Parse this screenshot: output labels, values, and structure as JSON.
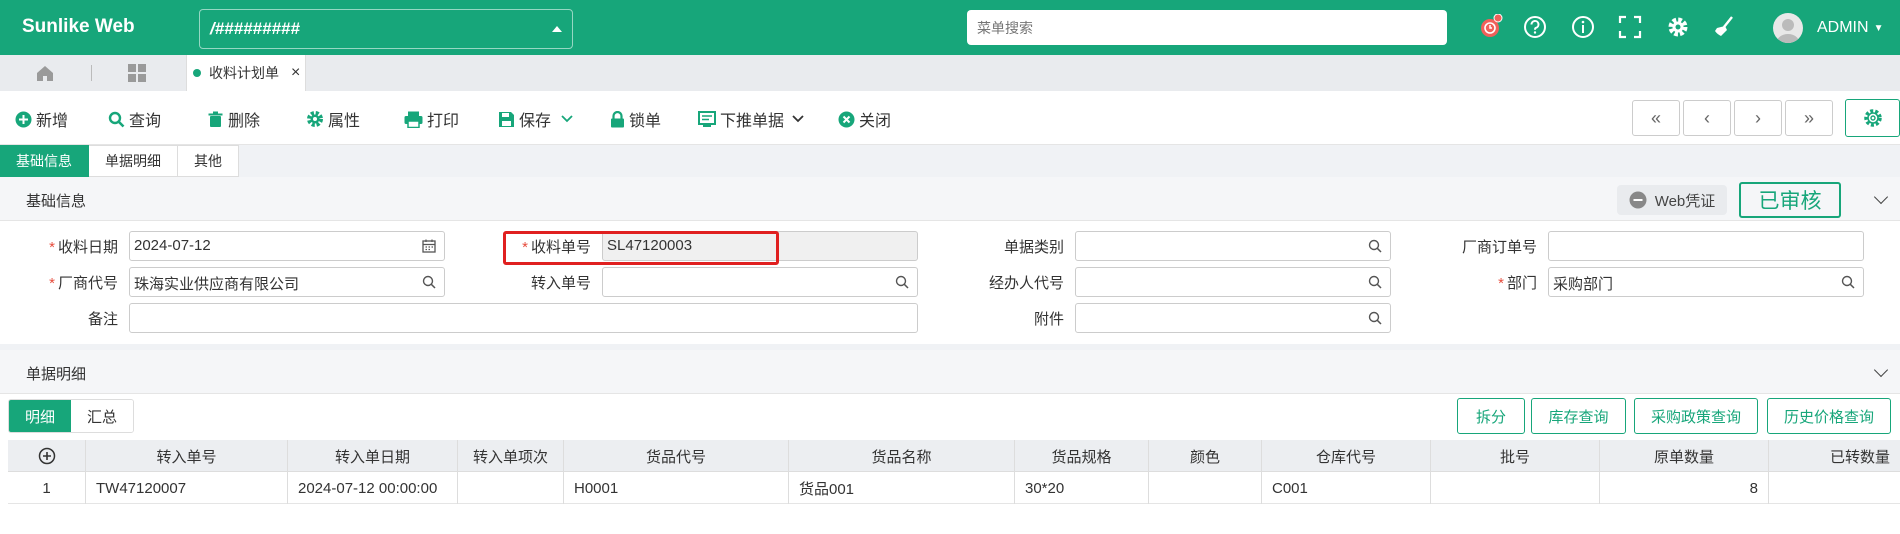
{
  "app": {
    "brand": "Sunlike Web",
    "db_select": "/#########",
    "menu_search_placeholder": "菜单搜索",
    "user": "ADMIN"
  },
  "tabs": {
    "active_tab": "收料计划单"
  },
  "toolbar": {
    "add": "新增",
    "query": "查询",
    "delete": "删除",
    "properties": "属性",
    "print": "打印",
    "save": "保存",
    "lock": "锁单",
    "push_down": "下推单据",
    "close": "关闭"
  },
  "section_tabs": [
    "基础信息",
    "单据明细",
    "其他"
  ],
  "basic": {
    "title": "基础信息",
    "web_voucher": "Web凭证",
    "status": "已审核",
    "fields": {
      "receive_date_label": "收料日期",
      "receive_date": "2024-07-12",
      "receive_no_label": "收料单号",
      "receive_no": "SL47120003",
      "doc_type_label": "单据类别",
      "doc_type": "",
      "vendor_order_label": "厂商订单号",
      "vendor_order": "",
      "vendor_code_label": "厂商代号",
      "vendor_code": "珠海实业供应商有限公司",
      "transfer_no_label": "转入单号",
      "transfer_no": "",
      "handler_label": "经办人代号",
      "handler": "",
      "dept_label": "部门",
      "dept": "采购部门",
      "remark_label": "备注",
      "remark": "",
      "attachment_label": "附件",
      "attachment": ""
    }
  },
  "detail": {
    "title": "单据明细",
    "subtabs": [
      "明细",
      "汇总"
    ],
    "actions": [
      "拆分",
      "库存查询",
      "采购政策查询",
      "历史价格查询"
    ],
    "columns": [
      "转入单号",
      "转入单日期",
      "转入单项次",
      "货品代号",
      "货品名称",
      "货品规格",
      "颜色",
      "仓库代号",
      "批号",
      "原单数量",
      "已转数量"
    ],
    "rows": [
      {
        "idx": "1",
        "transfer_no": "TW47120007",
        "transfer_date": "2024-07-12 00:00:00",
        "transfer_item": "",
        "item_code": "H0001",
        "item_name": "货品001",
        "spec": "30*20",
        "color": "",
        "warehouse": "C001",
        "batch": "",
        "orig_qty": "8",
        "transferred_qty": ""
      }
    ]
  }
}
